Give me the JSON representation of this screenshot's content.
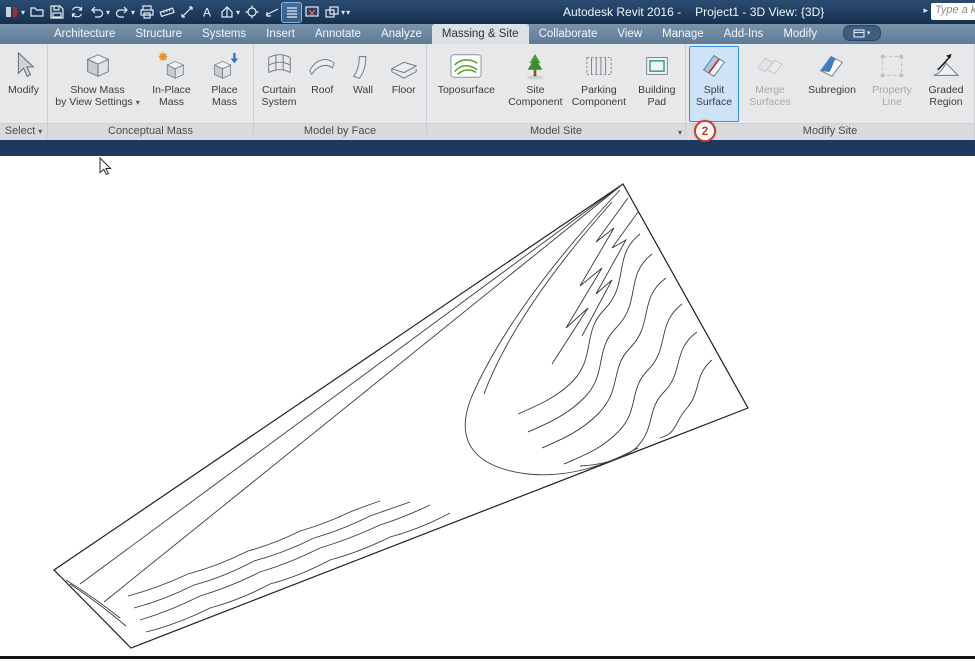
{
  "colors": {
    "titlebar_bg": "#1d3b5f",
    "tabbar_bg": "#5f7d9c",
    "active_tab_bg": "#dce1e5",
    "ribbon_bg": "#e7e8ea",
    "panel_label_bg": "#d9dbdd",
    "options_strip_bg": "#1c3a5e",
    "selected_button_bg": "#cfe3f7",
    "selected_button_border": "#3492e4",
    "annotation_red": "#ce3a2d"
  },
  "titlebar": {
    "title_left": "Autodesk Revit 2016 -",
    "title_right": "Project1 - 3D View: {3D}",
    "search_text": "Type a k"
  },
  "icons": {
    "caret_down": "▾",
    "caret_right": "▸",
    "text_glyph": "A"
  },
  "tabs": {
    "architecture": "Architecture",
    "structure": "Structure",
    "systems": "Systems",
    "insert": "Insert",
    "annotate": "Annotate",
    "analyze": "Analyze",
    "massing_site": "Massing & Site",
    "collaborate": "Collaborate",
    "view": "View",
    "manage": "Manage",
    "addins": "Add-Ins",
    "modify": "Modify"
  },
  "ribbon": {
    "modify": "Modify",
    "show_mass_l1": "Show Mass",
    "show_mass_l2": "by View Settings",
    "in_place_mass": "In-Place Mass",
    "place_mass": "Place Mass",
    "curtain_system": "Curtain System",
    "roof": "Roof",
    "wall": "Wall",
    "floor": "Floor",
    "toposurface": "Toposurface",
    "site_component": "Site Component",
    "parking_component": "Parking Component",
    "building_pad": "Building Pad",
    "split_surface": "Split Surface",
    "merge_surfaces": "Merge Surfaces",
    "subregion": "Subregion",
    "property_line": "Property Line",
    "graded_region": "Graded Region"
  },
  "panel_labels": {
    "select": "Select",
    "conceptual_mass": "Conceptual Mass",
    "model_by_face": "Model by Face",
    "model_site": "Model Site",
    "modify_site": "Modify Site"
  },
  "annotation": {
    "step_number": "2"
  }
}
